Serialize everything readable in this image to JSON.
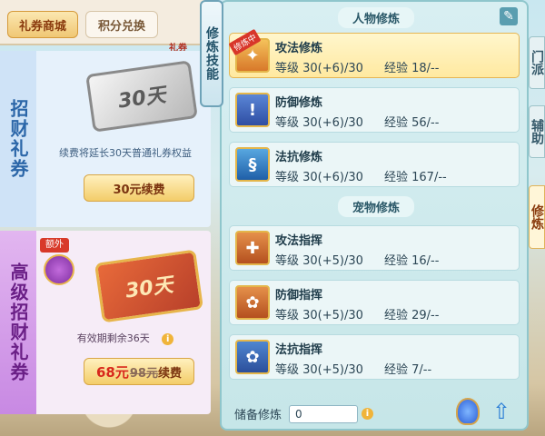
{
  "left_tabs": {
    "gift_shop": "礼券商城",
    "points_exchange": "积分兑换"
  },
  "gift_tag": "礼券",
  "card1": {
    "side_title": "招财礼券",
    "ticket_text": "30天",
    "description": "续费将延长30天普通礼券权益",
    "button": "30元续费"
  },
  "card2": {
    "badge": "额外",
    "side_title": "高级招财礼券",
    "ticket_text": "30天",
    "description": "有效期剩余36天",
    "button_new_price": "68元",
    "button_old_price": "98元",
    "button_suffix": "续费"
  },
  "skill_tab": "修炼技能",
  "practice": {
    "char_section": "人物修炼",
    "pet_section": "宠物修炼",
    "training_badge": "修炼中",
    "char_rows": [
      {
        "name": "攻法修炼",
        "level": "等级 30(+6)/30",
        "exp": "经验 18/--"
      },
      {
        "name": "防御修炼",
        "level": "等级 30(+6)/30",
        "exp": "经验 56/--"
      },
      {
        "name": "法抗修炼",
        "level": "等级 30(+6)/30",
        "exp": "经验 167/--"
      }
    ],
    "pet_rows": [
      {
        "name": "攻法指挥",
        "level": "等级 30(+5)/30",
        "exp": "经验 16/--"
      },
      {
        "name": "防御指挥",
        "level": "等级 30(+5)/30",
        "exp": "经验 29/--"
      },
      {
        "name": "法抗指挥",
        "level": "等级 30(+5)/30",
        "exp": "经验 7/--"
      }
    ],
    "reserve_label": "储备修炼",
    "reserve_value": "0"
  },
  "side_tabs": {
    "sect": "门派",
    "assist": "辅助",
    "practice": "修炼"
  },
  "icons": {
    "edit": "edit-icon",
    "info": "info-icon",
    "potion": "potion-icon",
    "upgrade": "upgrade-arrow-icon"
  },
  "colors": {
    "accent": "#f0c774",
    "panel": "#c6e6e8",
    "price": "#d8281c"
  }
}
